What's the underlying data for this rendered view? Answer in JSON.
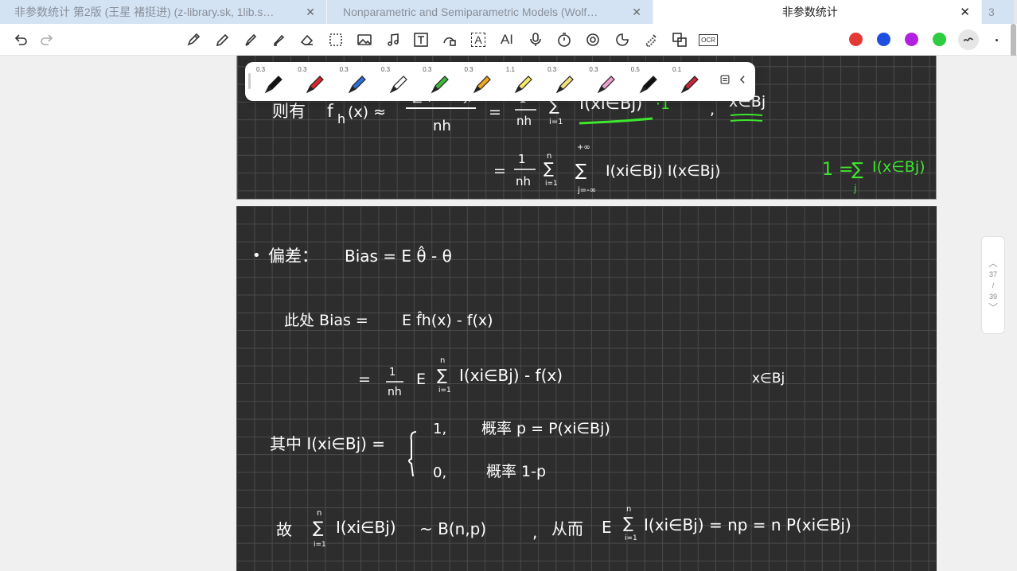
{
  "tabs": [
    {
      "title": "非参数统计 第2版 (王星 褚挺进) (z-library.sk, 1lib.s…",
      "active": false
    },
    {
      "title": "Nonparametric and Semiparametric Models (Wolf…",
      "active": false
    },
    {
      "title": "非参数统计",
      "active": true
    }
  ],
  "tab_count": "3",
  "toolbar": {
    "text_tool": "A",
    "ai_tool": "AI",
    "ocr_tool": "OCR"
  },
  "colors": {
    "red": "#e53935",
    "blue": "#1e4fe0",
    "purple": "#b321e0",
    "green": "#2ecc40"
  },
  "pens": [
    {
      "size": "0.3",
      "color": "#111111"
    },
    {
      "size": "0.3",
      "color": "#d9252c"
    },
    {
      "size": "0.3",
      "color": "#2a6fd4"
    },
    {
      "size": "0.3",
      "color": "#ffffff"
    },
    {
      "size": "0.3",
      "color": "#3fb93a"
    },
    {
      "size": "0.3",
      "color": "#f2a81d"
    },
    {
      "size": "1.1",
      "color": "#f6e66a"
    },
    {
      "size": "0.3",
      "color": "#f3e27a"
    },
    {
      "size": "0.3",
      "color": "#f0a0d0"
    },
    {
      "size": "0.5",
      "color": "#111111"
    },
    {
      "size": "0.1",
      "color": "#c6263a"
    }
  ],
  "page_indicator": {
    "current": "37",
    "sep": "/",
    "total": "39"
  },
  "notes": {
    "line1_prefix": "则有",
    "line1_f": "f",
    "line1_h": "h",
    "line1_x": "(x) ≈",
    "line1_num": "n∑I(xi∈Bj)",
    "line1_den": "nh",
    "line1_eq": "=",
    "frac_1": "1",
    "frac_nh": "nh",
    "sum_i1": "i=1",
    "sum_n": "n",
    "line1_ind": "I(xi∈Bj)",
    "line1_dot1": "·1",
    "line1_comma": ",",
    "line1_cond": "x∈Bj",
    "line2_eq": "=",
    "line2_inf": "+∞",
    "line2_jinf": "j=-∞",
    "line2_body": "I(xi∈Bj) I(x∈Bj)",
    "green_eq": "1 = ",
    "green_sum": "∑",
    "green_j": "j",
    "green_body": "I(x∈Bj)",
    "bias_bullet": "•",
    "bias_label": "偏差：",
    "bias_def": "Bias = E θ̂ - θ",
    "here_label": "此处 Bias =",
    "here_expr": "E f̂h(x)  -  f(x)",
    "here2_eq": "=",
    "here2_body": "E",
    "here2_ind": "I(xi∈Bj)  -  f(x)",
    "here2_cond": "x∈Bj",
    "where_label": "其中 I(xi∈Bj) =",
    "case1_val": "1,",
    "case1_prob": "概率 p = P(xi∈Bj)",
    "case2_val": "0,",
    "case2_prob": "概率 1-p",
    "thus_label": "故",
    "thus_ind": "I(xi∈Bj)",
    "thus_dist": "~  B(n,p)",
    "thus_comma": ",",
    "thus_hence": "从而",
    "thus_E": "E",
    "thus_ind2": "I(xi∈Bj) = np = n P(xi∈Bj)"
  }
}
